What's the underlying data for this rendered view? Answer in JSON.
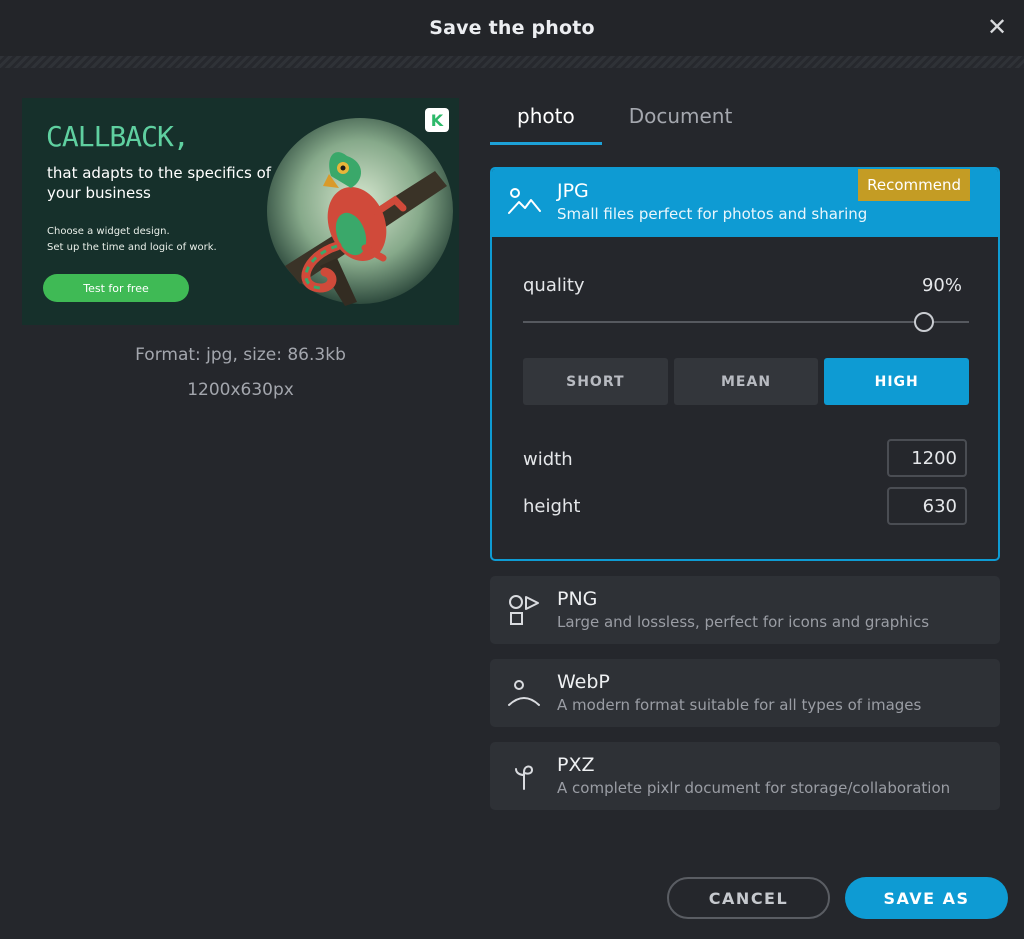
{
  "dialog": {
    "title": "Save the photo"
  },
  "preview": {
    "heading": "CALLBACK,",
    "subheading": "that adapts to the specifics of your business",
    "small_line_1": "Choose a widget design.",
    "small_line_2": "Set up the time and logic of work.",
    "cta": "Test for free",
    "logo_letter": "K",
    "format_info": "Format: jpg, size: 86.3kb",
    "dimensions": "1200x630px"
  },
  "tabs": [
    {
      "label": "photo",
      "active": true
    },
    {
      "label": "Document",
      "active": false
    }
  ],
  "formats": {
    "jpg": {
      "title": "JPG",
      "desc": "Small files perfect for photos and sharing",
      "badge": "Recommend",
      "quality_label": "quality",
      "quality_value": "90%",
      "quality_fraction": 0.9,
      "presets": [
        "SHORT",
        "MEAN",
        "HIGH"
      ],
      "active_preset": "HIGH",
      "width_label": "width",
      "width_value": "1200",
      "height_label": "height",
      "height_value": "630"
    },
    "png": {
      "title": "PNG",
      "desc": "Large and lossless, perfect for icons and graphics"
    },
    "webp": {
      "title": "WebP",
      "desc": "A modern format suitable for all types of images"
    },
    "pxz": {
      "title": "PXZ",
      "desc": "A complete pixlr document for storage/collaboration"
    }
  },
  "footer": {
    "cancel_label": "CANCEL",
    "save_label": "SAVE AS"
  },
  "colors": {
    "accent": "#0e9bd3",
    "badge": "#c49c24",
    "background": "#25272c"
  }
}
